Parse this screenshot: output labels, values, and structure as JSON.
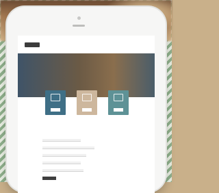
{
  "site": {
    "logo": "",
    "nav_links": [
      "",
      "",
      "",
      ""
    ],
    "hero_title": "",
    "cards": [
      {
        "button": ""
      },
      {
        "button": ""
      },
      {
        "button": ""
      }
    ],
    "form": {
      "title": "",
      "fields": [
        {
          "label": ""
        },
        {
          "label": ""
        },
        {
          "label": ""
        },
        {
          "label": ""
        },
        {
          "label": ""
        }
      ],
      "submit": ""
    }
  },
  "colors": {
    "card_1": "#3f6f86",
    "card_2": "#cdb79d",
    "card_3": "#5e9296",
    "stripe_green": "#8fb08c"
  }
}
